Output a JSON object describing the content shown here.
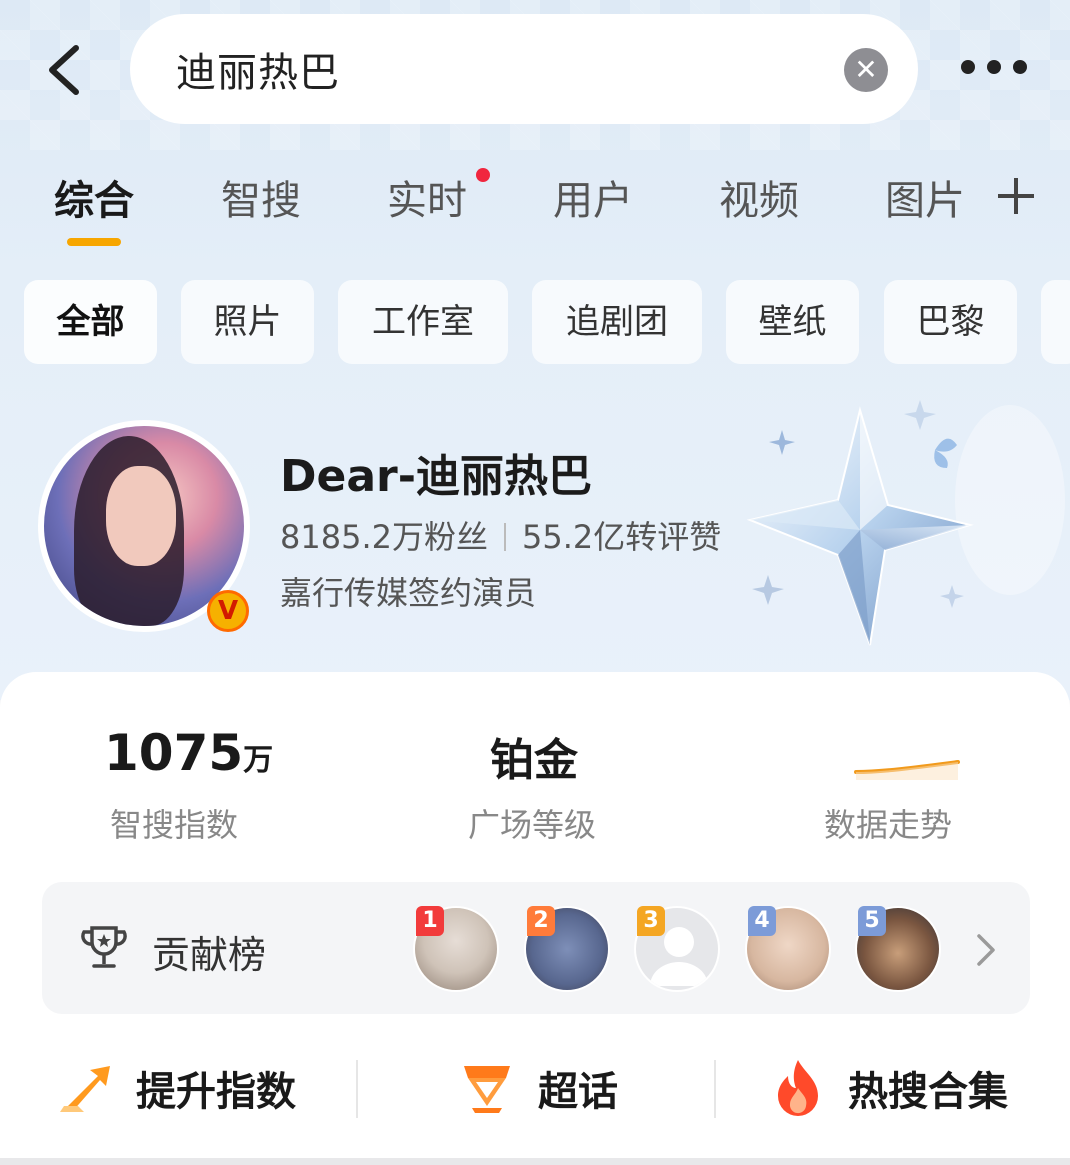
{
  "search": {
    "query": "迪丽热巴"
  },
  "tabs": [
    {
      "label": "综合",
      "active": true
    },
    {
      "label": "智搜",
      "active": false
    },
    {
      "label": "实时",
      "active": false,
      "dot": true
    },
    {
      "label": "用户",
      "active": false
    },
    {
      "label": "视频",
      "active": false
    },
    {
      "label": "图片",
      "active": false
    }
  ],
  "chips": [
    {
      "label": "全部",
      "active": true
    },
    {
      "label": "照片"
    },
    {
      "label": "工作室"
    },
    {
      "label": "追剧团"
    },
    {
      "label": "壁纸"
    },
    {
      "label": "巴黎"
    }
  ],
  "profile": {
    "name": "Dear-迪丽热巴",
    "fans": "8185.2万粉丝",
    "interactions": "55.2亿转评赞",
    "org": "嘉行传媒签约演员",
    "verified_badge": "V"
  },
  "metrics": {
    "index_value": "1075",
    "index_unit": "万",
    "index_label": "智搜指数",
    "level_value": "铂金",
    "level_label": "广场等级",
    "trend_label": "数据走势"
  },
  "contribution": {
    "label": "贡献榜",
    "ranks": [
      "1",
      "2",
      "3",
      "4",
      "5"
    ]
  },
  "actions": {
    "boost": "提升指数",
    "supertopic": "超话",
    "hot_collection": "热搜合集"
  },
  "colors": {
    "accent": "#f7a600",
    "red_dot": "#f0263e"
  }
}
